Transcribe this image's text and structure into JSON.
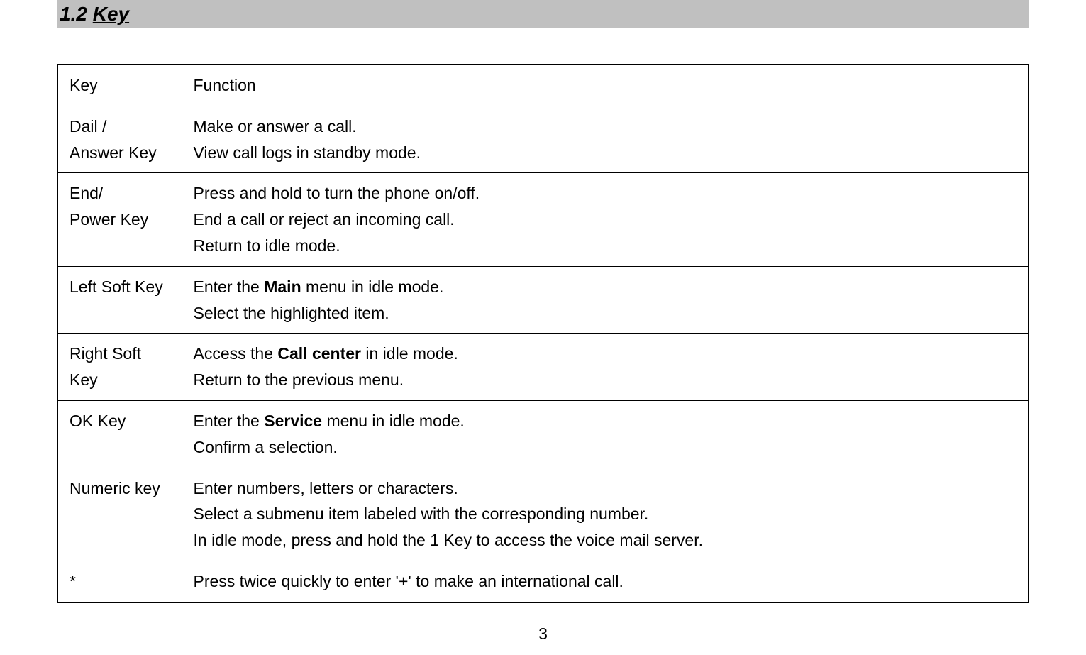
{
  "section": {
    "number": "1.2",
    "title": "Key"
  },
  "table": {
    "header": {
      "col1": "Key",
      "col2": "Function"
    },
    "rows": [
      {
        "key_line1": "Dail /",
        "key_line2": "Answer Key",
        "func_line1": "Make or answer a call.",
        "func_line2": "View call logs in standby mode."
      },
      {
        "key_line1": "End/",
        "key_line2": "Power Key",
        "func_line1": "Press and hold to turn the phone on/off.",
        "func_line2": "End a call or reject an incoming call.",
        "func_line3": "Return to idle mode."
      },
      {
        "key_line1": "Left Soft Key",
        "func_line1_pre": "Enter the ",
        "func_line1_bold": "Main",
        "func_line1_post": " menu in idle mode.",
        "func_line2": "Select the highlighted item."
      },
      {
        "key_line1": "Right Soft",
        "key_line2": "Key",
        "func_line1_pre": "Access the ",
        "func_line1_bold": "Call center",
        "func_line1_post": " in idle mode.",
        "func_line2": "Return to the previous menu."
      },
      {
        "key_line1": "OK Key",
        "func_line1_pre": "Enter the ",
        "func_line1_bold": "Service",
        "func_line1_post": " menu in idle mode.",
        "func_line2": "Confirm a selection."
      },
      {
        "key_line1": "Numeric key",
        "func_line1": "Enter numbers, letters or characters.",
        "func_line2": "Select a submenu item labeled with the corresponding number.",
        "func_line3": "In idle mode, press and hold the 1 Key to access the voice mail server."
      },
      {
        "key_line1": "*",
        "func_line1": "Press twice quickly to enter '+' to make an international call."
      }
    ]
  },
  "page_number": "3"
}
